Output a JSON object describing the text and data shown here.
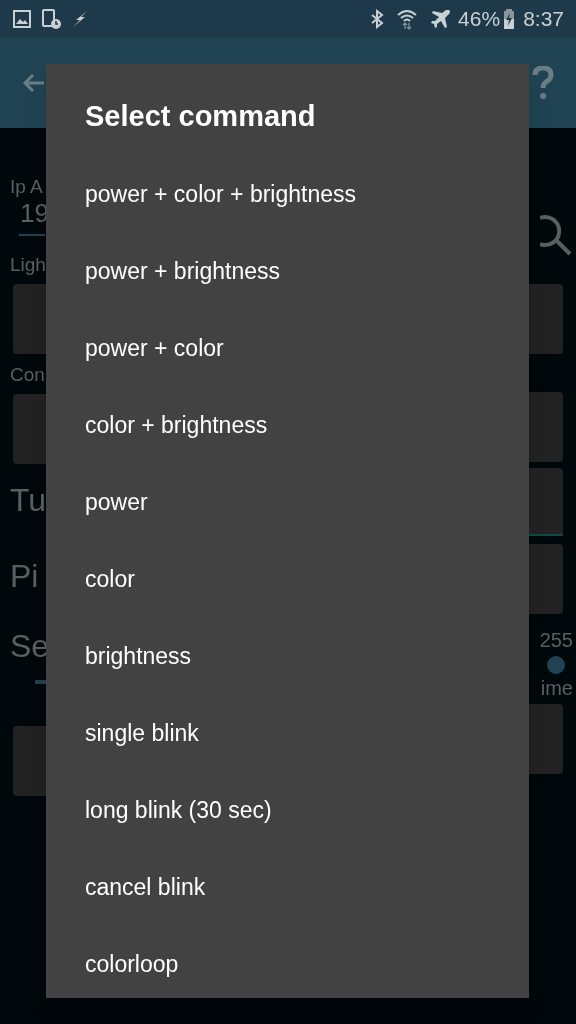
{
  "status_bar": {
    "battery": "46%",
    "time": "8:37"
  },
  "background": {
    "left_texts": [
      {
        "kind": "label",
        "text": "Ip A"
      },
      {
        "kind": "value",
        "text": "19"
      },
      {
        "kind": "label",
        "text": "Ligh"
      },
      {
        "kind": "box"
      },
      {
        "kind": "label",
        "text": "Con"
      },
      {
        "kind": "box"
      },
      {
        "kind": "heading",
        "text": "Tu"
      },
      {
        "kind": "heading",
        "text": "Pi"
      },
      {
        "kind": "heading",
        "text": "Se"
      },
      {
        "kind": "slider"
      },
      {
        "kind": "box"
      }
    ],
    "right_texts": [
      {
        "kind": "search"
      },
      {
        "kind": "box"
      },
      {
        "kind": "box"
      },
      {
        "kind": "tab-box"
      },
      {
        "kind": "box"
      },
      {
        "kind": "label",
        "text": "255"
      },
      {
        "kind": "slider"
      },
      {
        "kind": "label",
        "text": "ime"
      },
      {
        "kind": "box"
      }
    ]
  },
  "dialog": {
    "title": "Select command",
    "items": [
      "power + color + brightness",
      "power + brightness",
      "power + color",
      "color + brightness",
      "power",
      "color",
      "brightness",
      "single blink",
      "long blink (30 sec)",
      "cancel blink",
      "colorloop"
    ]
  }
}
